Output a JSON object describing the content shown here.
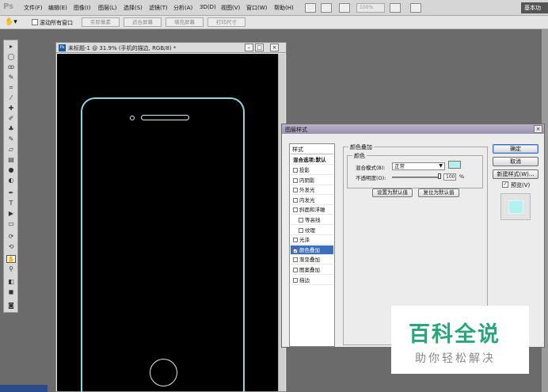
{
  "app": {
    "logo": "Ps"
  },
  "menubar": {
    "items": [
      "文件(F)",
      "编辑(E)",
      "图像(I)",
      "图层(L)",
      "选择(S)",
      "滤镜(T)",
      "分析(A)",
      "3D(D)",
      "视图(V)",
      "窗口(W)",
      "帮助(H)"
    ],
    "zoom": "100%",
    "workspace": "基本功"
  },
  "optionsbar": {
    "scroll_all_label": "滚动所有窗口",
    "buttons": [
      "实际像素",
      "适合屏幕",
      "填充屏幕",
      "打印尺寸"
    ]
  },
  "document": {
    "title": "未标题-1 @ 31.9% (手机的描边, RGB/8) *",
    "badge": "Ps",
    "win_buttons": [
      "–",
      "□",
      "×"
    ]
  },
  "dialog": {
    "title": "图层样式",
    "close": "×",
    "styles_header": "样式",
    "blend_options": "混合选项:默认",
    "effects": [
      {
        "label": "投影",
        "checked": false,
        "indent": false
      },
      {
        "label": "内阴影",
        "checked": false,
        "indent": false
      },
      {
        "label": "外发光",
        "checked": false,
        "indent": false
      },
      {
        "label": "内发光",
        "checked": false,
        "indent": false
      },
      {
        "label": "斜面和浮雕",
        "checked": false,
        "indent": false
      },
      {
        "label": "等高线",
        "checked": false,
        "indent": true
      },
      {
        "label": "纹理",
        "checked": false,
        "indent": true
      },
      {
        "label": "光泽",
        "checked": false,
        "indent": false
      },
      {
        "label": "颜色叠加",
        "checked": true,
        "indent": false,
        "selected": true
      },
      {
        "label": "渐变叠加",
        "checked": false,
        "indent": false
      },
      {
        "label": "图案叠加",
        "checked": false,
        "indent": false
      },
      {
        "label": "描边",
        "checked": false,
        "indent": false
      }
    ],
    "section_title": "颜色叠加",
    "subsection_title": "颜色",
    "blend_mode_label": "混合模式(B):",
    "blend_mode_value": "正常",
    "opacity_label": "不透明度(O):",
    "opacity_value": "100",
    "opacity_unit": "%",
    "set_default": "设置为默认值",
    "reset_default": "复位为默认值",
    "ok": "确定",
    "cancel": "取消",
    "new_style": "新建样式(W)...",
    "preview_label": "预览(V)",
    "preview_checked": true,
    "overlay_color": "#b4f1ee"
  },
  "watermark": {
    "title": "百科全说",
    "subtitle": "助你轻松解决"
  }
}
